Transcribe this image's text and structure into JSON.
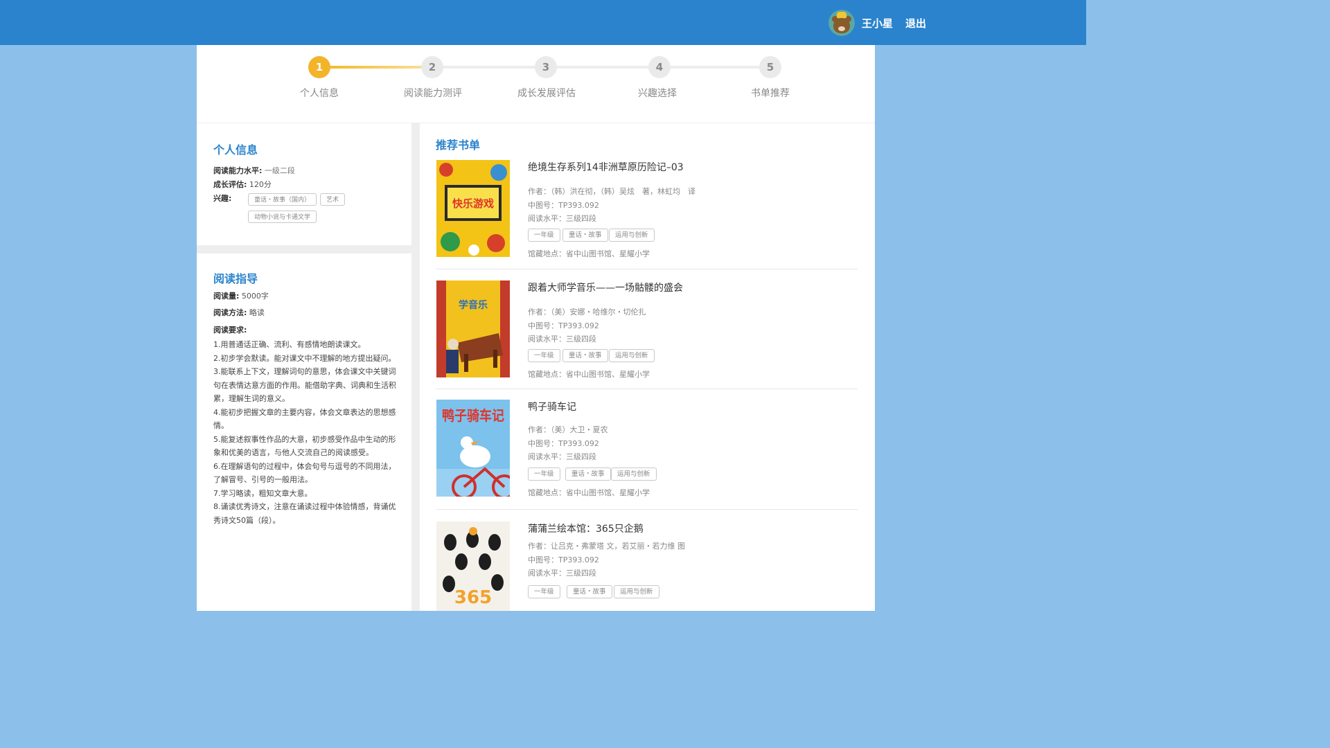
{
  "header": {
    "user_name": "王小星",
    "logout_label": "退出",
    "bar_color": "#2a83cc"
  },
  "steps": [
    {
      "num": "1",
      "label": "个人信息",
      "active": true
    },
    {
      "num": "2",
      "label": "阅读能力测评",
      "active": false
    },
    {
      "num": "3",
      "label": "成长发展评估",
      "active": false
    },
    {
      "num": "4",
      "label": "兴趣选择",
      "active": false
    },
    {
      "num": "5",
      "label": "书单推荐",
      "active": false
    }
  ],
  "profile": {
    "title": "个人信息",
    "level_label": "阅读能力水平:",
    "level_value": "一级二段",
    "growth_label": "成长评估:",
    "growth_value": "120分",
    "interest_label": "兴趣:",
    "interests": [
      "童话・故事（国内）",
      "艺术",
      "动物小说与卡通文学"
    ]
  },
  "guide": {
    "title": "阅读指导",
    "amount_label": "阅读量:",
    "amount_value": "5000字",
    "method_label": "阅读方法:",
    "method_value": "略读",
    "req_label": "阅读要求:",
    "requirements": [
      "1.用普通话正确、流利、有感情地朗读课文。",
      "2.初步学会默读。能对课文中不理解的地方提出疑问。",
      "3.能联系上下文，理解词句的意思，体会课文中关键词句在表情达意方面的作用。能借助字典、词典和生活积累，理解生词的意义。",
      "4.能初步把握文章的主要内容，体会文章表达的思想感情。",
      "5.能复述叙事性作品的大意，初步感受作品中生动的形象和优美的语言，与他人交流自己的阅读感受。",
      "6.在理解语句的过程中，体会句号与逗号的不同用法，了解冒号、引号的一般用法。",
      "7.学习略读，粗知文章大意。",
      "8.诵读优秀诗文，注意在诵读过程中体验情感，背诵优秀诗文50篇（段）。"
    ]
  },
  "books_title": "推荐书单",
  "books": [
    {
      "title": "绝境生存系列14非洲草原历险记–03",
      "author": "作者：（韩）洪在彻，（韩）吴炫　著，林虹均　译",
      "clc": "中图号：TP393.092",
      "level": "阅读水平：三级四段",
      "tags": [
        "一年级",
        "童话・故事",
        "运用与创新"
      ],
      "location": "馆藏地点：省中山图书馆、星耀小学",
      "cover_text": "快乐游戏"
    },
    {
      "title": "跟着大师学音乐——一场骷髅的盛会",
      "author": "作者：（美）安娜・哈维尔・切伦扎",
      "clc": "中图号：TP393.092",
      "level": "阅读水平：三级四段",
      "tags": [
        "一年级",
        "童话・故事",
        "运用与创新"
      ],
      "location": "馆藏地点：省中山图书馆、星耀小学",
      "cover_text": "学音乐"
    },
    {
      "title": "鸭子骑车记",
      "author": "作者：（美）大卫・夏农",
      "clc": "中图号：TP393.092",
      "level": "阅读水平：三级四段",
      "tags": [
        "一年级",
        "童话・故事",
        "运用与创新"
      ],
      "location": "馆藏地点：省中山图书馆、星耀小学",
      "cover_text": "鸭子骑车记"
    },
    {
      "title": "蒲蒲兰绘本馆：365只企鹅",
      "author": "作者：让吕克・弗蒙塔 文，若艾丽・若力维 图",
      "clc": "中图号：TP393.092",
      "level": "阅读水平：三级四段",
      "tags": [
        "一年级",
        "童话・故事",
        "运用与创新"
      ],
      "cover_text": "365"
    }
  ]
}
